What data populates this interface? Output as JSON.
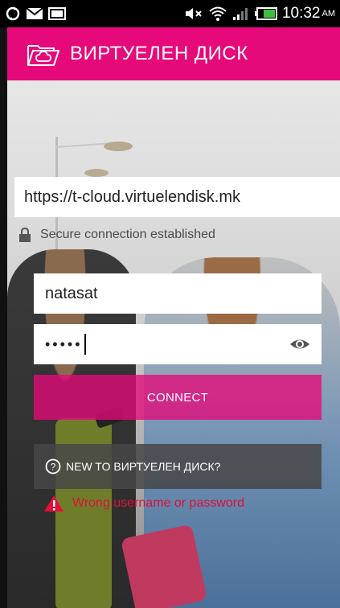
{
  "statusbar": {
    "time": "10:32",
    "ampm": "AM",
    "icons": [
      "sync-icon",
      "mail-icon",
      "image-icon",
      "mute-icon",
      "wifi-icon",
      "signal-icon",
      "battery-icon"
    ]
  },
  "appbar": {
    "title": "ВИРТУЕЛЕН ДИСК",
    "icon": "cloud-folder-icon",
    "color": "#e6097a"
  },
  "login": {
    "server_url": "https://t-cloud.virtuelendisk.mk",
    "secure_text": "Secure connection established",
    "username": "natasat",
    "password_masked": "•••••",
    "connect_label": "CONNECT",
    "new_to_label": "NEW TO ВИРТУЕЛЕН ДИСК?",
    "error_text": "Wrong username or password"
  },
  "colors": {
    "accent": "#e6097a",
    "error": "#e0103a"
  }
}
